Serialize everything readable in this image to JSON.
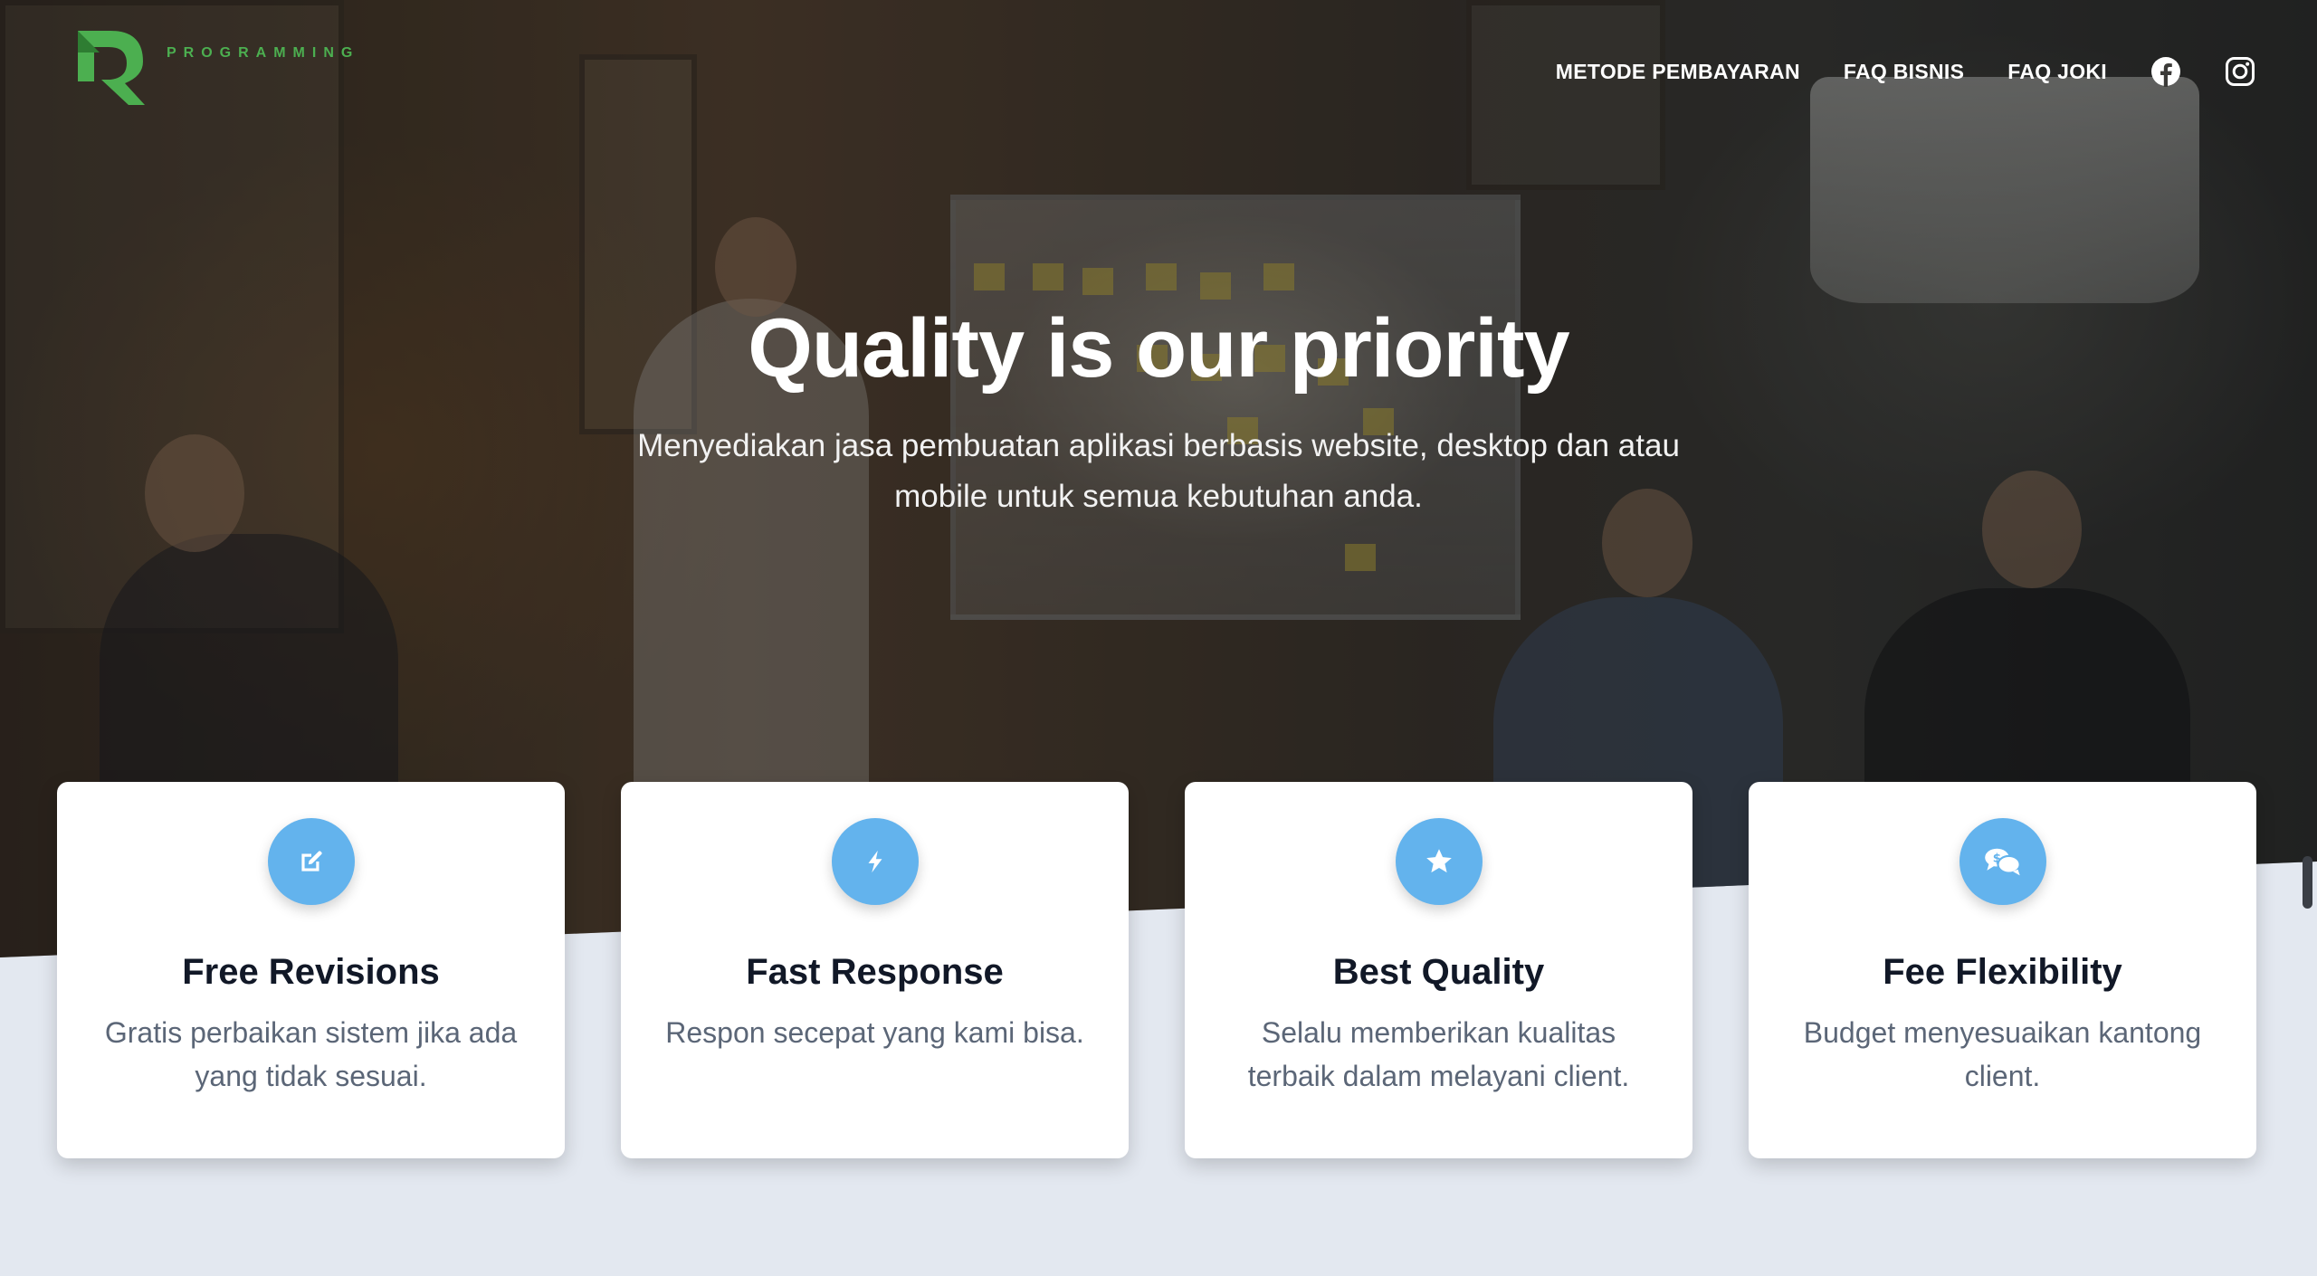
{
  "brand": {
    "logo_text": "PROGRAMMING",
    "accent": "#4caf50"
  },
  "nav": {
    "links": [
      "METODE PEMBAYARAN",
      "FAQ BISNIS",
      "FAQ JOKI"
    ],
    "social": [
      "facebook-icon",
      "instagram-icon"
    ]
  },
  "hero": {
    "title": "Quality is our priority",
    "subtitle": "Menyediakan jasa pembuatan aplikasi berbasis website, desktop dan atau mobile untuk semua kebutuhan anda."
  },
  "features": [
    {
      "icon": "edit-icon",
      "title": "Free Revisions",
      "text": "Gratis perbaikan sistem jika ada yang tidak sesuai."
    },
    {
      "icon": "bolt-icon",
      "title": "Fast Response",
      "text": "Respon secepat yang kami bisa."
    },
    {
      "icon": "star-icon",
      "title": "Best Quality",
      "text": "Selalu memberikan kualitas terbaik dalam melayani client."
    },
    {
      "icon": "chat-dollar-icon",
      "title": "Fee Flexibility",
      "text": "Budget menyesuaikan kantong client."
    }
  ],
  "colors": {
    "icon_bg": "#63b3ed",
    "page_bg": "#e3e8f0"
  }
}
